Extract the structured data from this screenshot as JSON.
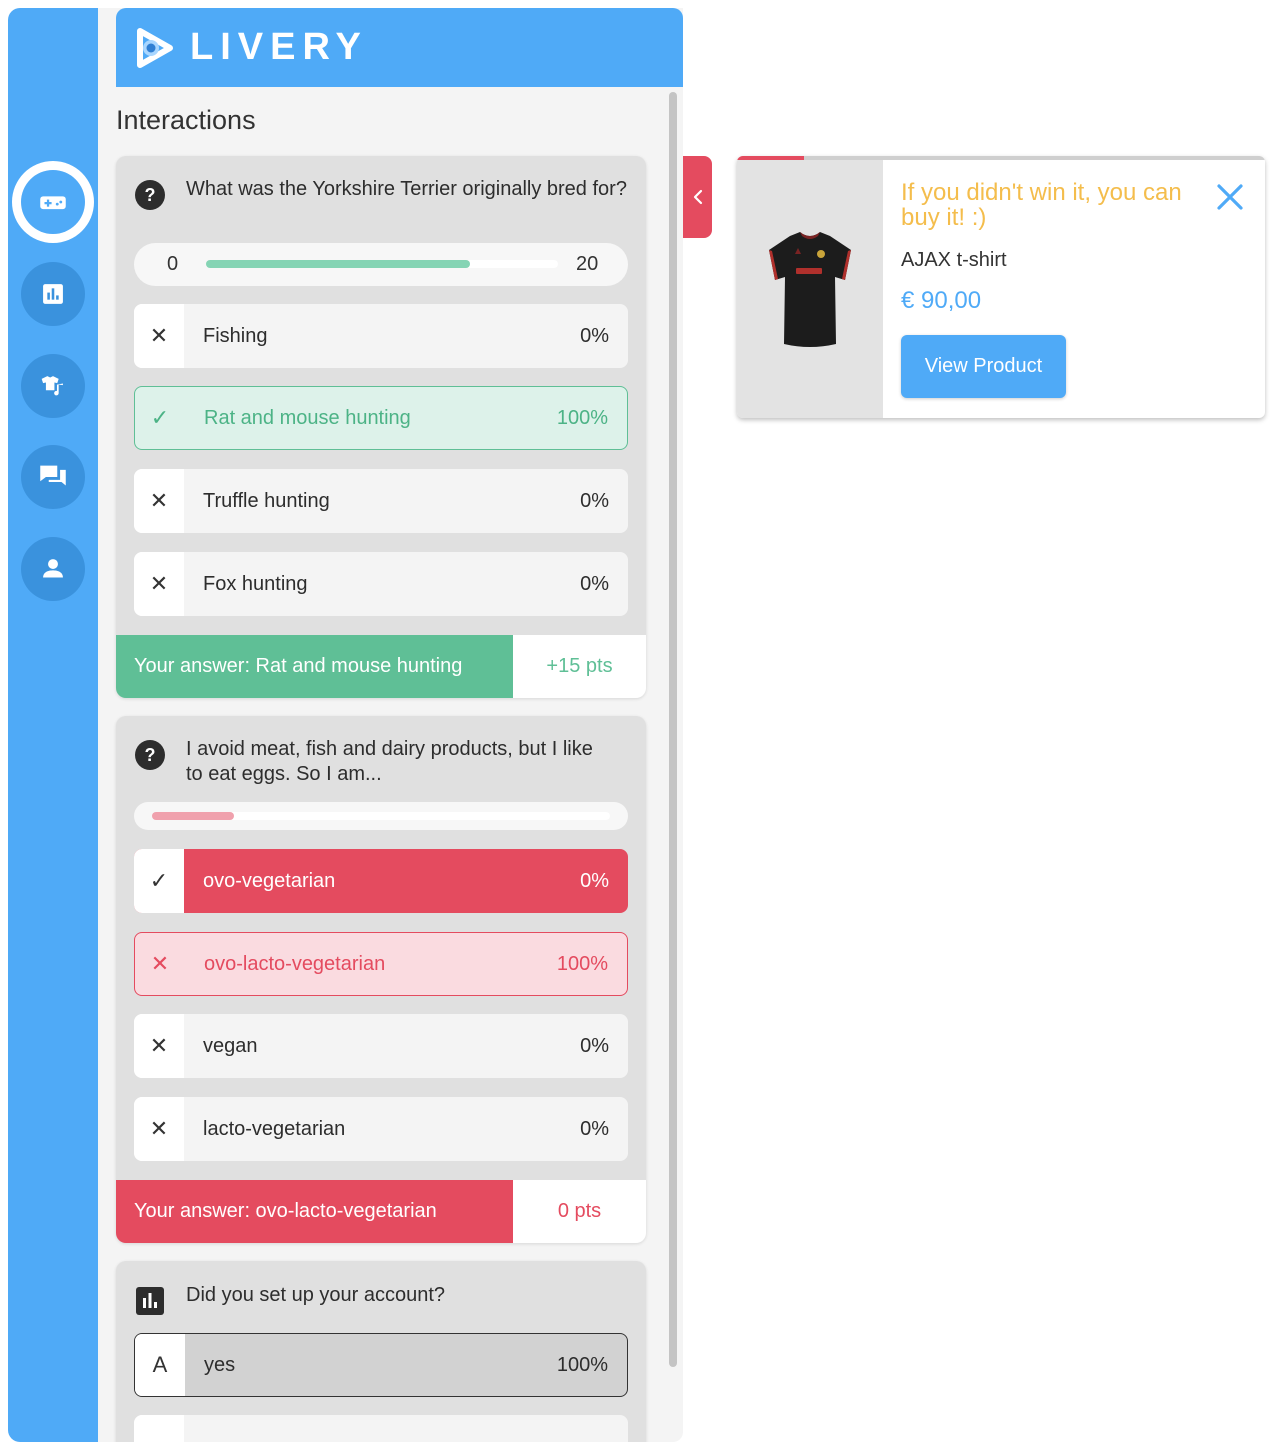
{
  "brand": {
    "name": "LIVERY"
  },
  "colors": {
    "primary": "#4faaf7",
    "success": "#5fbf96",
    "danger": "#e44b5f",
    "accent": "#f4bd4c"
  },
  "nav": {
    "items": [
      "game-controller-icon",
      "bar-chart-icon",
      "shirt-music-icon",
      "chat-icon",
      "user-icon"
    ],
    "active": 0
  },
  "panel": {
    "title": "Interactions"
  },
  "quiz1": {
    "question": "What was the Yorkshire Terrier originally bred for?",
    "timer": {
      "min": "0",
      "max": "20",
      "progress": 0.75
    },
    "options": [
      {
        "label": "Fishing",
        "pct": "0%",
        "mark": "✕"
      },
      {
        "label": "Rat and mouse hunting",
        "pct": "100%",
        "mark": "✓"
      },
      {
        "label": "Truffle hunting",
        "pct": "0%",
        "mark": "✕"
      },
      {
        "label": "Fox hunting",
        "pct": "0%",
        "mark": "✕"
      }
    ],
    "answer": "Your answer: Rat and mouse hunting",
    "points": "+15 pts"
  },
  "quiz2": {
    "question": "I avoid meat, fish and dairy products, but I like to eat eggs. So I am...",
    "timer": {
      "progress": 0.18
    },
    "options": [
      {
        "label": "ovo-vegetarian",
        "pct": "0%",
        "mark": "✓"
      },
      {
        "label": "ovo-lacto-vegetarian",
        "pct": "100%",
        "mark": "✕"
      },
      {
        "label": "vegan",
        "pct": "0%",
        "mark": "✕"
      },
      {
        "label": "lacto-vegetarian",
        "pct": "0%",
        "mark": "✕"
      }
    ],
    "answer": "Your answer: ovo-lacto-vegetarian",
    "points": "0 pts"
  },
  "poll": {
    "question": "Did you set up your account?",
    "options": [
      {
        "letter": "A",
        "label": "yes",
        "pct": "100%"
      }
    ]
  },
  "product": {
    "headline": "If you didn't win it, you can buy it! :)",
    "name": "AJAX t-shirt",
    "price": "€ 90,00",
    "button": "View Product",
    "image_alt": "black football shirt"
  }
}
